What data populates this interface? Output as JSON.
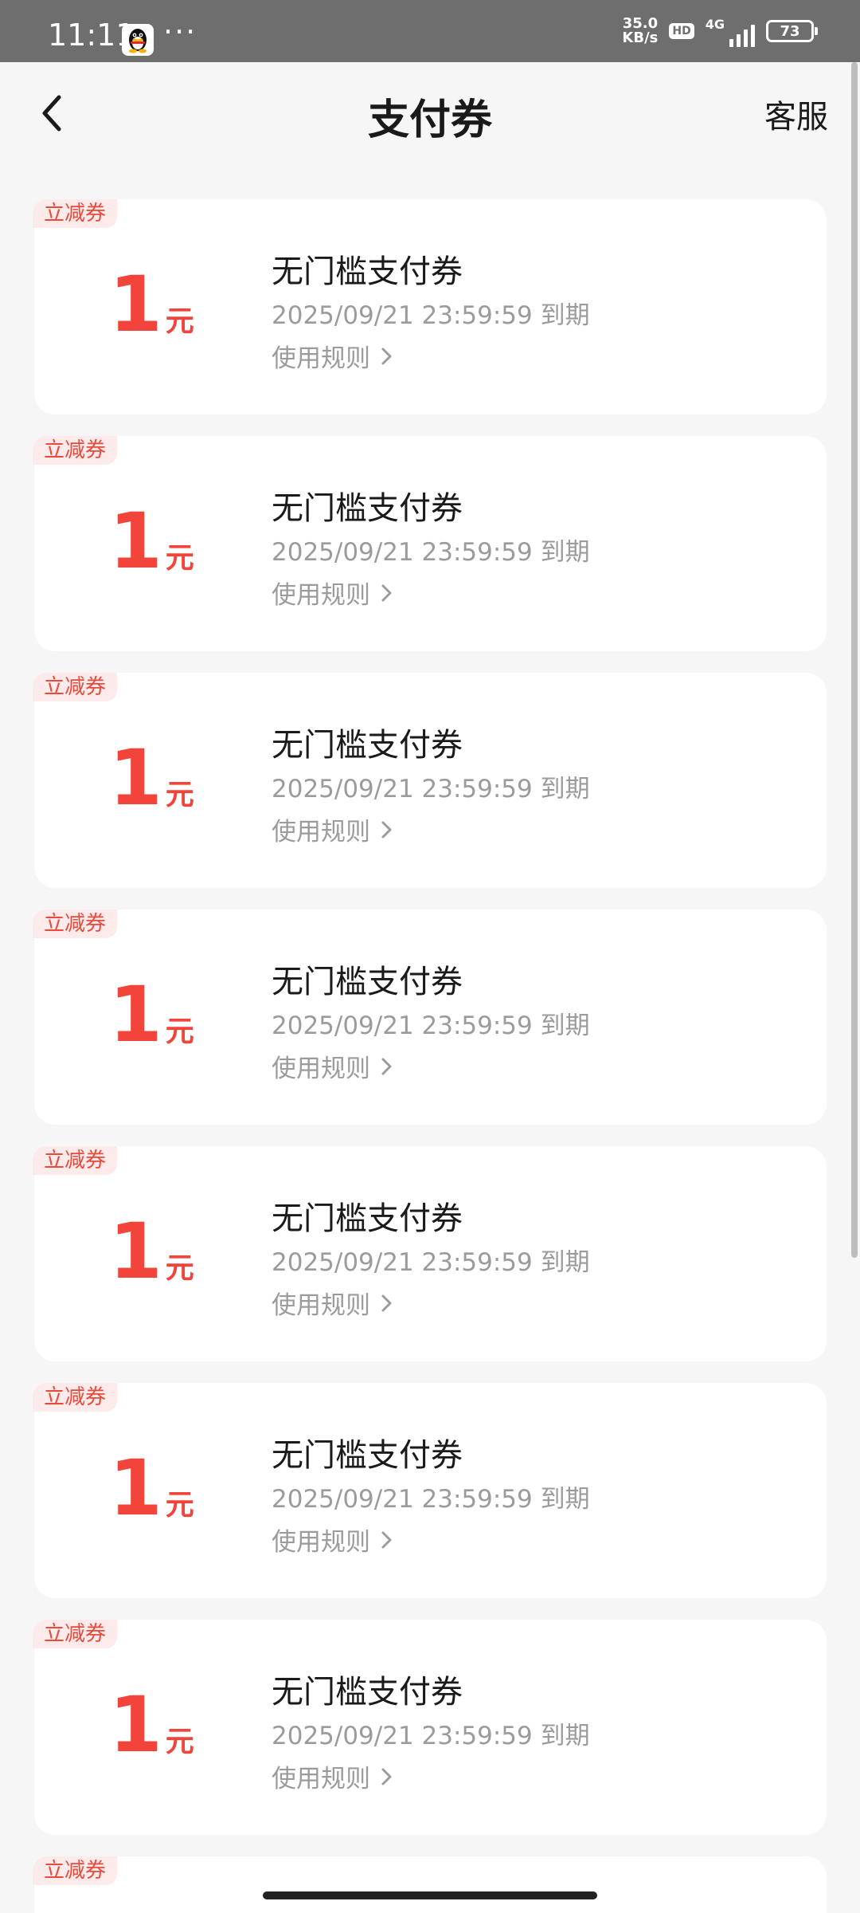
{
  "status_bar": {
    "time": "11:11",
    "dots": "···",
    "net_speed_value": "35.0",
    "net_speed_unit": "KB/s",
    "hd": "HD",
    "network": "4G",
    "battery": "73"
  },
  "header": {
    "title": "支付券",
    "service": "客服"
  },
  "coupons": [
    {
      "tag": "立减券",
      "amount": "1",
      "unit": "元",
      "name": "无门槛支付券",
      "expiry": "2025/09/21 23:59:59 到期",
      "rules": "使用规则"
    },
    {
      "tag": "立减券",
      "amount": "1",
      "unit": "元",
      "name": "无门槛支付券",
      "expiry": "2025/09/21 23:59:59 到期",
      "rules": "使用规则"
    },
    {
      "tag": "立减券",
      "amount": "1",
      "unit": "元",
      "name": "无门槛支付券",
      "expiry": "2025/09/21 23:59:59 到期",
      "rules": "使用规则"
    },
    {
      "tag": "立减券",
      "amount": "1",
      "unit": "元",
      "name": "无门槛支付券",
      "expiry": "2025/09/21 23:59:59 到期",
      "rules": "使用规则"
    },
    {
      "tag": "立减券",
      "amount": "1",
      "unit": "元",
      "name": "无门槛支付券",
      "expiry": "2025/09/21 23:59:59 到期",
      "rules": "使用规则"
    },
    {
      "tag": "立减券",
      "amount": "1",
      "unit": "元",
      "name": "无门槛支付券",
      "expiry": "2025/09/21 23:59:59 到期",
      "rules": "使用规则"
    },
    {
      "tag": "立减券",
      "amount": "1",
      "unit": "元",
      "name": "无门槛支付券",
      "expiry": "2025/09/21 23:59:59 到期",
      "rules": "使用规则"
    },
    {
      "tag": "立减券"
    }
  ],
  "colors": {
    "accent": "#f2443a",
    "tag_background": "#fdeaea",
    "page_background": "#f6f6f6",
    "status_bar": "#6e6e6e"
  },
  "icons": {
    "back": "chevron-left-icon",
    "app": "qq-icon",
    "rules": "chevron-right-icon"
  }
}
